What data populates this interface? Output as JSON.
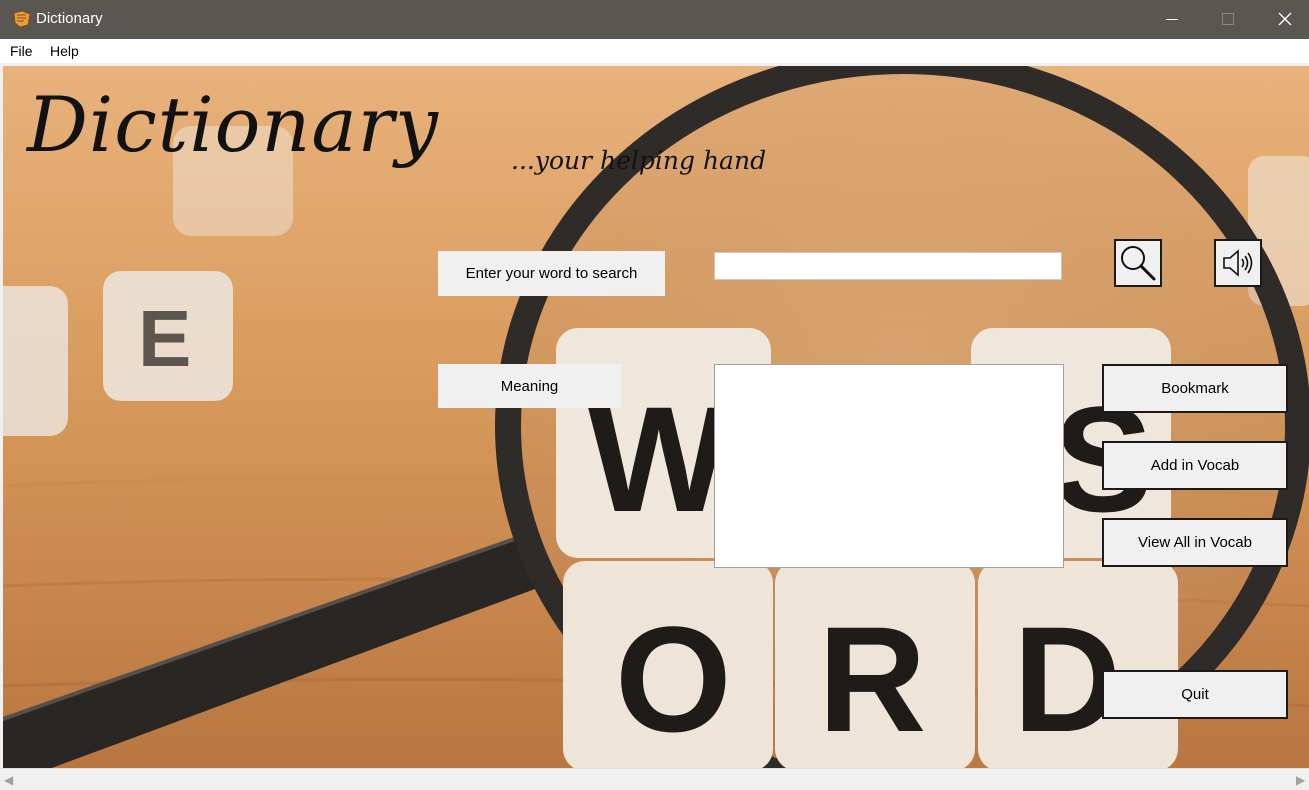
{
  "window": {
    "title": "Dictionary"
  },
  "menu": {
    "file": "File",
    "help": "Help"
  },
  "header": {
    "logo": "Dictionary",
    "tagline": "...your helping hand"
  },
  "search": {
    "label": "Enter your word to search",
    "value": "",
    "placeholder": ""
  },
  "meaning": {
    "label": "Meaning",
    "value": ""
  },
  "buttons": {
    "bookmark": "Bookmark",
    "add_vocab": "Add in Vocab",
    "view_all_vocab": "View All in Vocab",
    "quit": "Quit"
  },
  "icons": {
    "search": "magnifier-icon",
    "speak": "speaker-icon"
  },
  "colors": {
    "titlebar": "#5a5651",
    "button_border": "#1a1a1a",
    "button_bg": "#f0f0f0",
    "logo_text": "#121212"
  }
}
